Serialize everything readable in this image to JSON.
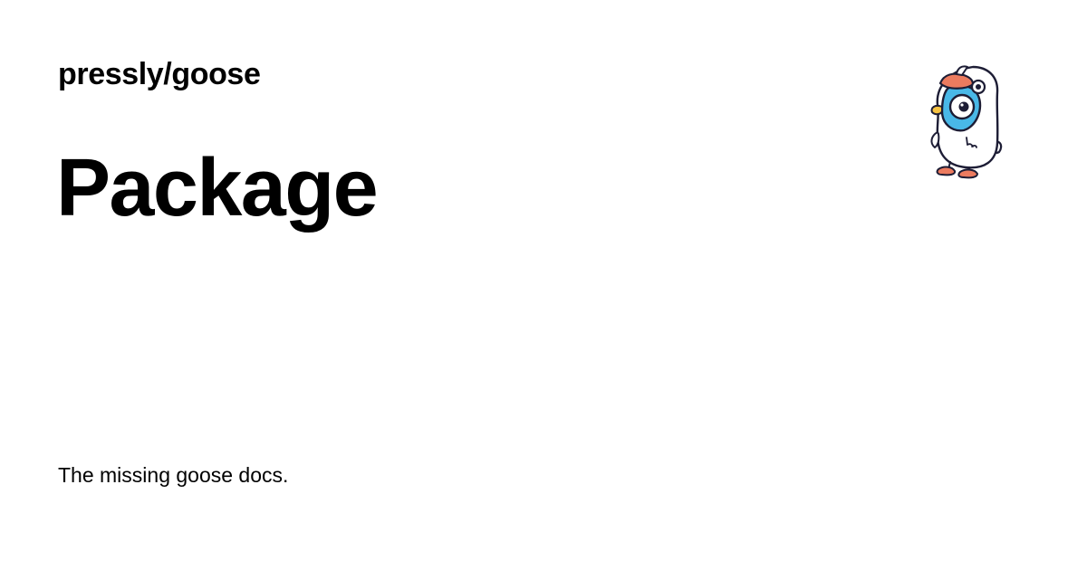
{
  "header": {
    "repo": "pressly/goose"
  },
  "main": {
    "title": "Package",
    "description": "The missing goose docs."
  },
  "logo": {
    "icon": "goose-mascot-icon",
    "colors": {
      "outline": "#1d1d35",
      "body": "#ffffff",
      "face": "#49b8e7",
      "beak_feet": "#ec7b5f",
      "accent": "#f6c343"
    }
  }
}
